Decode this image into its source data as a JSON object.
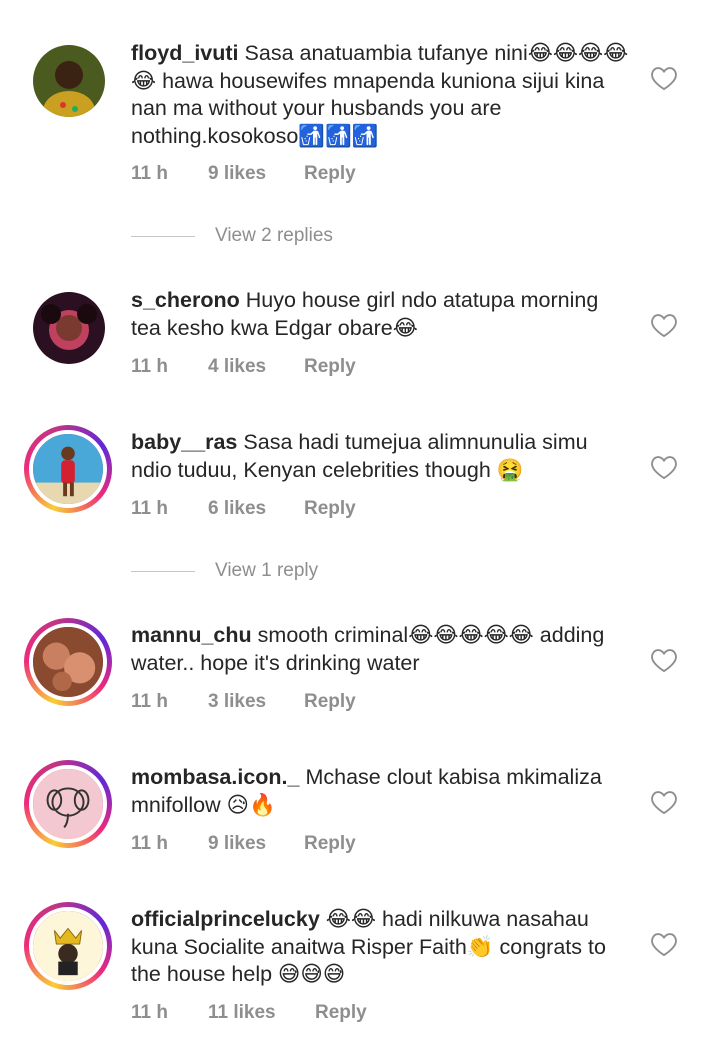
{
  "comments": [
    {
      "username": "floyd_ivuti",
      "text": "Sasa anatuambia tufanye nini😂😂😂😂😂 hawa housewifes mnapenda kuniona sijui kina nan ma without your husbands you are nothing.kosokoso🚮🚮🚮",
      "time": "11 h",
      "likes": "9 likes",
      "reply": "Reply"
    },
    {
      "username": "s_cherono",
      "text": "Huyo house girl ndo atatupa morning tea kesho kwa Edgar obare😂",
      "time": "11 h",
      "likes": "4 likes",
      "reply": "Reply"
    },
    {
      "username": "baby__ras",
      "text": "Sasa hadi tumejua alimnunulia simu ndio tuduu, Kenyan celebrities though 🤮",
      "time": "11 h",
      "likes": "6 likes",
      "reply": "Reply"
    },
    {
      "username": "mannu_chu",
      "text": "smooth criminal😂😂😂😂😂 adding water.. hope it's drinking water",
      "time": "11 h",
      "likes": "3 likes",
      "reply": "Reply"
    },
    {
      "username": "mombasa.icon._",
      "text": "Mchase clout kabisa mkimaliza mnifollow 😥🔥",
      "time": "11 h",
      "likes": "9 likes",
      "reply": "Reply"
    },
    {
      "username": "officialprincelucky",
      "text": "😂😂 hadi nilkuwa nasahau kuna Socialite anaitwa Risper Faith👏 congrats to the house help 😅😅😅",
      "time": "11 h",
      "likes": "11 likes",
      "reply": "Reply"
    }
  ],
  "view_replies": [
    {
      "label": "View 2 replies"
    },
    {
      "label": "View 1 reply"
    }
  ],
  "icons": {
    "like": "heart-outline-icon"
  },
  "colors": {
    "text": "#262626",
    "muted": "#8e8e8e",
    "ring_start": "#f9ce34",
    "ring_mid": "#ee2a7b",
    "ring_end": "#6228d7"
  }
}
